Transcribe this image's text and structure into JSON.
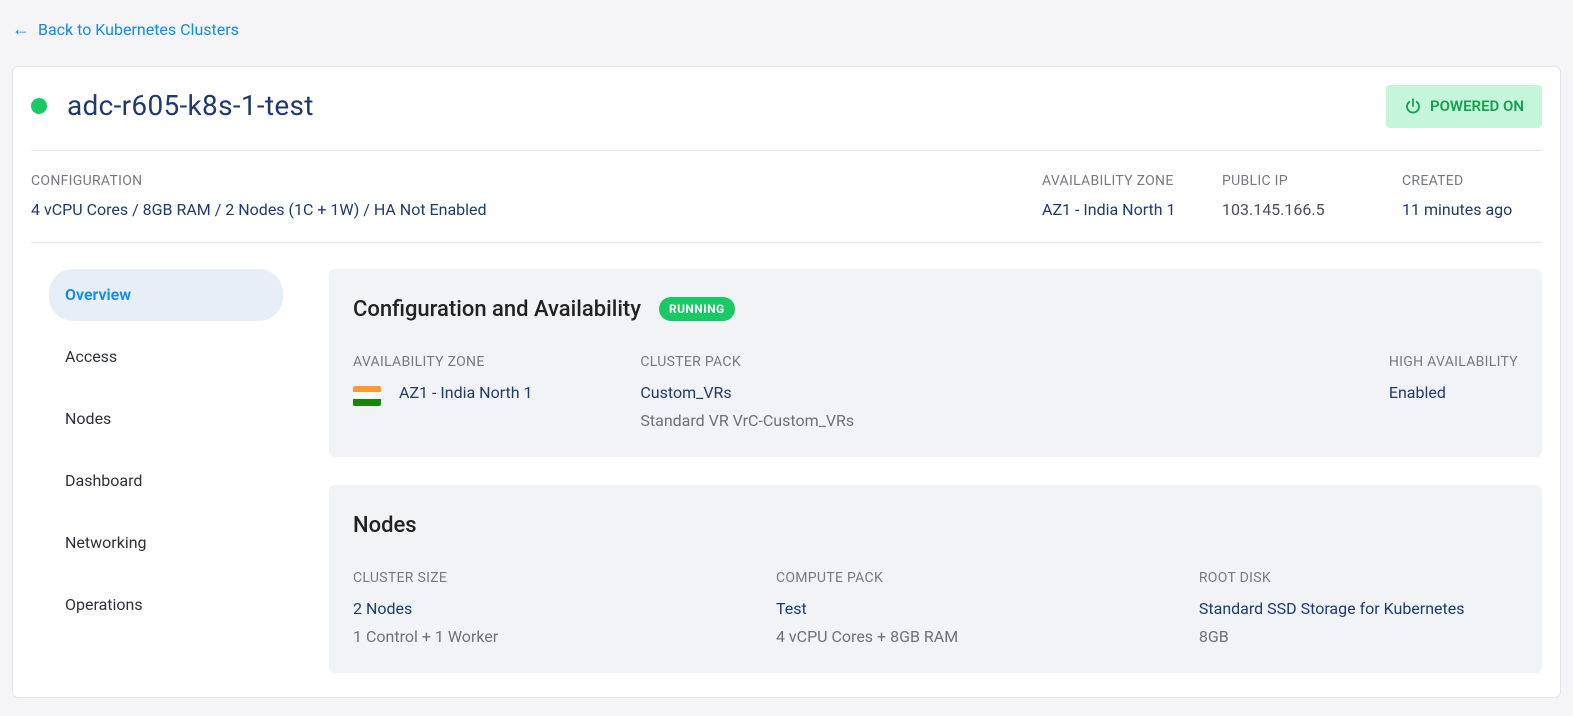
{
  "back_link": "Back to Kubernetes Clusters",
  "cluster_name": "adc-r605-k8s-1-test",
  "power_status": "POWERED ON",
  "summary": {
    "configuration_label": "CONFIGURATION",
    "configuration_value": "4 vCPU Cores / 8GB RAM / 2 Nodes (1C + 1W) / HA Not Enabled",
    "az_label": "AVAILABILITY ZONE",
    "az_value": "AZ1 - India North 1",
    "public_ip_label": "PUBLIC IP",
    "public_ip_value": "103.145.166.5",
    "created_label": "CREATED",
    "created_value": "11 minutes ago"
  },
  "tabs": {
    "overview": "Overview",
    "access": "Access",
    "nodes": "Nodes",
    "dashboard": "Dashboard",
    "networking": "Networking",
    "operations": "Operations"
  },
  "config_panel": {
    "title": "Configuration and Availability",
    "badge": "RUNNING",
    "az_label": "AVAILABILITY ZONE",
    "az_value": "AZ1 - India North 1",
    "pack_label": "CLUSTER PACK",
    "pack_value": "Custom_VRs",
    "pack_sub": "Standard VR VrC-Custom_VRs",
    "ha_label": "HIGH AVAILABILITY",
    "ha_value": "Enabled"
  },
  "nodes_panel": {
    "title": "Nodes",
    "size_label": "CLUSTER SIZE",
    "size_value": "2 Nodes",
    "size_sub": "1 Control + 1 Worker",
    "compute_label": "COMPUTE PACK",
    "compute_value": "Test",
    "compute_sub": "4 vCPU Cores + 8GB RAM",
    "disk_label": "ROOT DISK",
    "disk_value": "Standard SSD Storage for Kubernetes",
    "disk_sub": "8GB"
  }
}
